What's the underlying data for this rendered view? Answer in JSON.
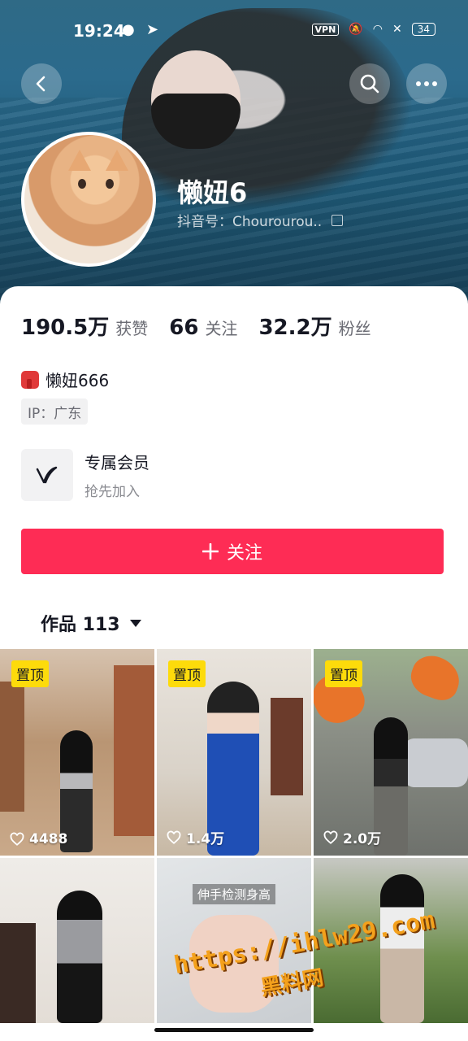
{
  "status_bar": {
    "time": "19:24",
    "vpn": "VPN",
    "battery": "34"
  },
  "profile": {
    "username": "懒妞6",
    "douyin_id": "抖音号：Chourourou.."
  },
  "stats": [
    {
      "num": "190.5万",
      "label": "获赞"
    },
    {
      "num": "66",
      "label": "关注"
    },
    {
      "num": "32.2万",
      "label": "粉丝"
    }
  ],
  "bio": {
    "text": "懒妞666",
    "ip": "IP：广东"
  },
  "member": {
    "title": "专属会员",
    "subtitle": "抢先加入"
  },
  "follow_button": "关注",
  "works_tab": "作品 113",
  "grid": [
    {
      "pinned": "置顶",
      "likes": "4488"
    },
    {
      "pinned": "置顶",
      "likes": "1.4万"
    },
    {
      "pinned": "置顶",
      "likes": "2.0万"
    },
    {
      "pinned": "",
      "likes": ""
    },
    {
      "pinned": "",
      "likes": "",
      "overlay": "伸手检测身高"
    },
    {
      "pinned": "",
      "likes": ""
    }
  ],
  "watermark": {
    "line1": "https://ihlw29.com",
    "line2": "黑料网"
  },
  "colors": {
    "accent": "#fe2c55",
    "pin_badge": "#fddb0b"
  },
  "icons": [
    "back-icon",
    "search-icon",
    "more-icon",
    "copy-icon",
    "scarf-icon",
    "member-v-icon",
    "plus-icon",
    "caret-down-icon",
    "heart-icon"
  ]
}
